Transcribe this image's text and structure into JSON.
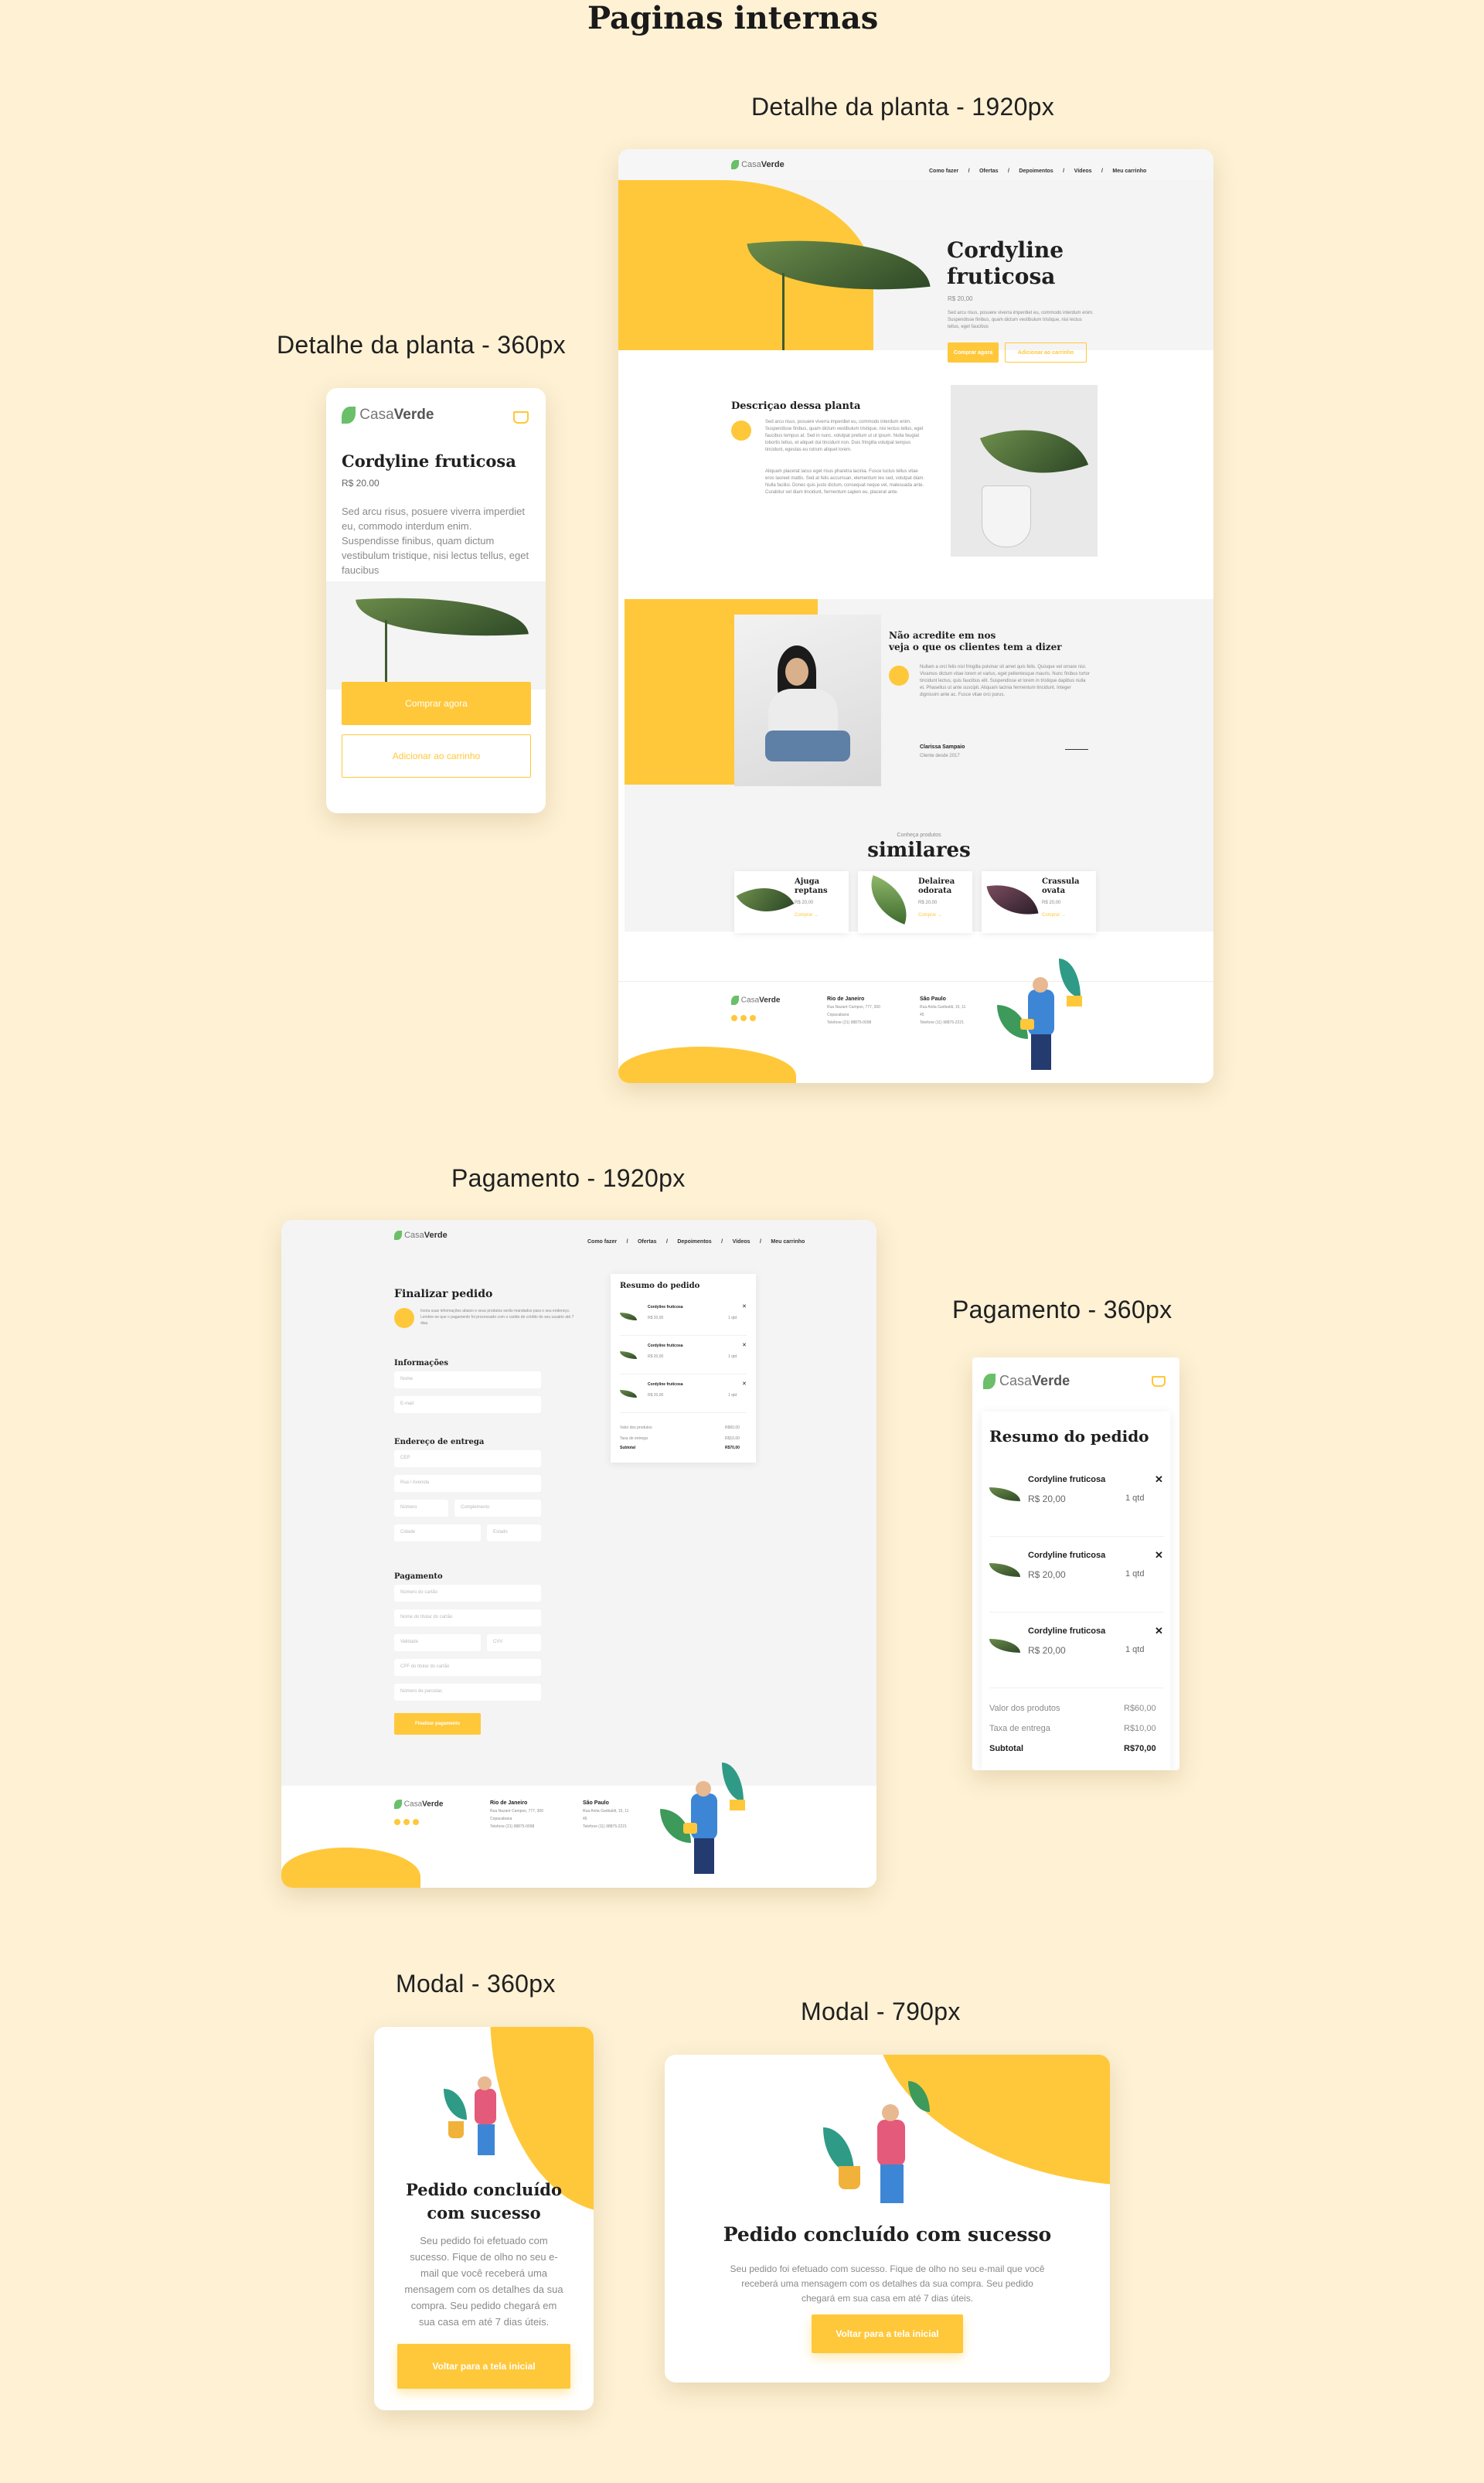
{
  "main_title": "Paginas internas",
  "captions": {
    "detail_1920": "Detalhe da planta - 1920px",
    "detail_360": "Detalhe da planta - 360px",
    "payment_1920": "Pagamento - 1920px",
    "payment_360": "Pagamento - 360px",
    "modal_360": "Modal - 360px",
    "modal_790": "Modal - 790px"
  },
  "brand": {
    "part1": "Casa",
    "part2": "Verde"
  },
  "nav": [
    "Como fazer",
    "/",
    "Ofertas",
    "/",
    "Depoimentos",
    "/",
    "Vídeos",
    "/",
    "Meu carrinho"
  ],
  "detail_desktop": {
    "product_title_line1": "Cordyline",
    "product_title_line2": "fruticosa",
    "price": "R$ 20,00",
    "desc_short": "Sed arcu risus, posuere viverra imperdiet eu, commodo interdum enim. Suspendisse finibus, quam dictum vestibulum tristique, nisi lectus tellus, eget faucibus",
    "buy_label": "Comprar agora",
    "cart_label": "Adicionar ao carrinho",
    "section_title": "Descriçao dessa planta",
    "section_text_1": "Sed arcu risus, posuere viverra imperdiet eu, commodo interdum enim. Suspendisse finibus, quam dictum vestibulum tristique, nisi lectus tellus, eget faucibus tempus at. Sed in nunc, volutpat pretium ut ut ipsum. Nulla feugiat lobortis tellus, et aliquet dui tincidunt non. Duis fringilla volutpat tempus tincidunt, egestas eu rutrum aliquet lorem.",
    "section_text_2": "Aliquam placerat lacus eget risus pharetra lacinia. Fusce luctus tellus vitae eros laoreet mattis. Sed at felis accumsan, elementum leo sed, volutpat diam. Nulla facilisi. Donec quis justo dictum, consequat neque vel, malesuada ante. Curabitur vel diam tincidunt, fermentum sapien eu, placerat ante.",
    "testimonial_heading_1": "Não acredite em nos",
    "testimonial_heading_2": "veja o que os clientes tem a dizer",
    "testimonial_text": "Nullam a orci felis nisl fringilla pulvinar sit amet quis felis. Quisque vel ornare nisi. Vivamus dictum vitae lorem et varius, eget pellentesque mauris. Nunc finibus tortor tincidunt lectus, quis faucibus elit. Suspendisse et lorem in tristique dapibus nulla et. Phasellus ut ante suscipit. Aliquam lacinia fermentum tincidunt. Integer dignissim ante ac. Fusce vitae orci purus.",
    "testimonial_author": "Clarissa Sampaio",
    "testimonial_location": "Cliente desde 2017",
    "similar_kicker": "Conheça produtos",
    "similar_title": "similares",
    "similar_items": [
      {
        "name_1": "Ajuga",
        "name_2": "reptans",
        "price": "R$ 20,00",
        "cta": "Comprar →"
      },
      {
        "name_1": "Delairea",
        "name_2": "odorata",
        "price": "R$ 20,00",
        "cta": "Comprar →"
      },
      {
        "name_1": "Crassula",
        "name_2": "ovata",
        "price": "R$ 20,00",
        "cta": "Comprar →"
      }
    ],
    "footer": {
      "col1_title": "Rio de Janeiro",
      "col1_lines": [
        "Rua Nazaré Campos, 777, 300",
        "Copacabana",
        "Telefone (21) 98875-0098"
      ],
      "col2_title": "São Paulo",
      "col2_lines": [
        "Rua Anita Garibaldi, 15, 11",
        "45",
        "Telefone (11) 98875-2221"
      ]
    }
  },
  "detail_mobile": {
    "title": "Cordyline fruticosa",
    "price": "R$ 20.00",
    "description": "Sed arcu risus, posuere viverra imperdiet eu, commodo interdum enim. Suspendisse finibus, quam dictum vestibulum tristique, nisi lectus tellus, eget faucibus",
    "buy_label": "Comprar agora",
    "cart_label": "Adicionar ao carrinho"
  },
  "payment_desktop": {
    "title": "Finalizar pedido",
    "intro": "Insira suas informações abaixo e seus produtos serão mandados para o seu endereço. Lembre-se que o pagamento foi processado com o cartão de crédito do seu usuário até 7 dias.",
    "section_info": "Informações",
    "field_name": "Nome",
    "field_email": "E-mail",
    "section_address": "Endereço de entrega",
    "field_cep": "CEP",
    "field_street": "Rua / Avenida",
    "field_number": "Número",
    "field_complement": "Complemento",
    "field_city": "Cidade",
    "field_state": "Estado",
    "section_payment": "Pagamento",
    "field_card_number": "Número do cartão",
    "field_card_name": "Nome do titular do cartão",
    "field_validity": "Validade",
    "field_cvv": "CVV",
    "field_cpf": "CPF do titular do cartão",
    "field_installments": "Número de parcelas",
    "confirm_label": "Finalizar pagamento",
    "summary_title": "Resumo do pedido",
    "summary_items": [
      {
        "name": "Cordyline fruticosa",
        "price": "R$ 20,00",
        "qty": "1 qtd"
      },
      {
        "name": "Cordyline fruticosa",
        "price": "R$ 20,00",
        "qty": "1 qtd"
      },
      {
        "name": "Cordyline fruticosa",
        "price": "R$ 20,00",
        "qty": "1 qtd"
      }
    ],
    "subtotal_label": "Valor dos produtos",
    "subtotal_value": "R$60,00",
    "delivery_label": "Taxa de entrega",
    "delivery_value": "R$10,00",
    "total_label": "Subtotal",
    "total_value": "R$70,00"
  },
  "payment_mobile": {
    "title": "Resumo do pedido",
    "items": [
      {
        "name": "Cordyline fruticosa",
        "price": "R$ 20,00",
        "qty": "1 qtd"
      },
      {
        "name": "Cordyline fruticosa",
        "price": "R$ 20,00",
        "qty": "1 qtd"
      },
      {
        "name": "Cordyline fruticosa",
        "price": "R$ 20,00",
        "qty": "1 qtd"
      }
    ],
    "subtotal_label": "Valor dos produtos",
    "subtotal_value": "R$60,00",
    "delivery_label": "Taxa de entrega",
    "delivery_value": "R$10,00",
    "total_label": "Subtotal",
    "total_value": "R$70,00"
  },
  "modal_mobile": {
    "title_1": "Pedido concluído",
    "title_2": "com sucesso",
    "text": "Seu pedido foi efetuado com sucesso. Fique de olho no seu e-mail que você receberá uma mensagem com os detalhes da sua compra. Seu pedido chegará em sua casa em até 7 dias úteis.",
    "button": "Voltar para a tela inicial"
  },
  "modal_desktop": {
    "title": "Pedido concluído com sucesso",
    "text": "Seu pedido foi efetuado com sucesso. Fique de olho no seu e-mail que você receberá uma mensagem com os detalhes da sua compra. Seu pedido chegará em sua casa em até 7 dias úteis.",
    "button": "Voltar para a tela inicial"
  },
  "colors": {
    "background": "#fef1d4",
    "accent": "#ffc83a",
    "leaf": "#6abf69",
    "text": "#202020"
  }
}
